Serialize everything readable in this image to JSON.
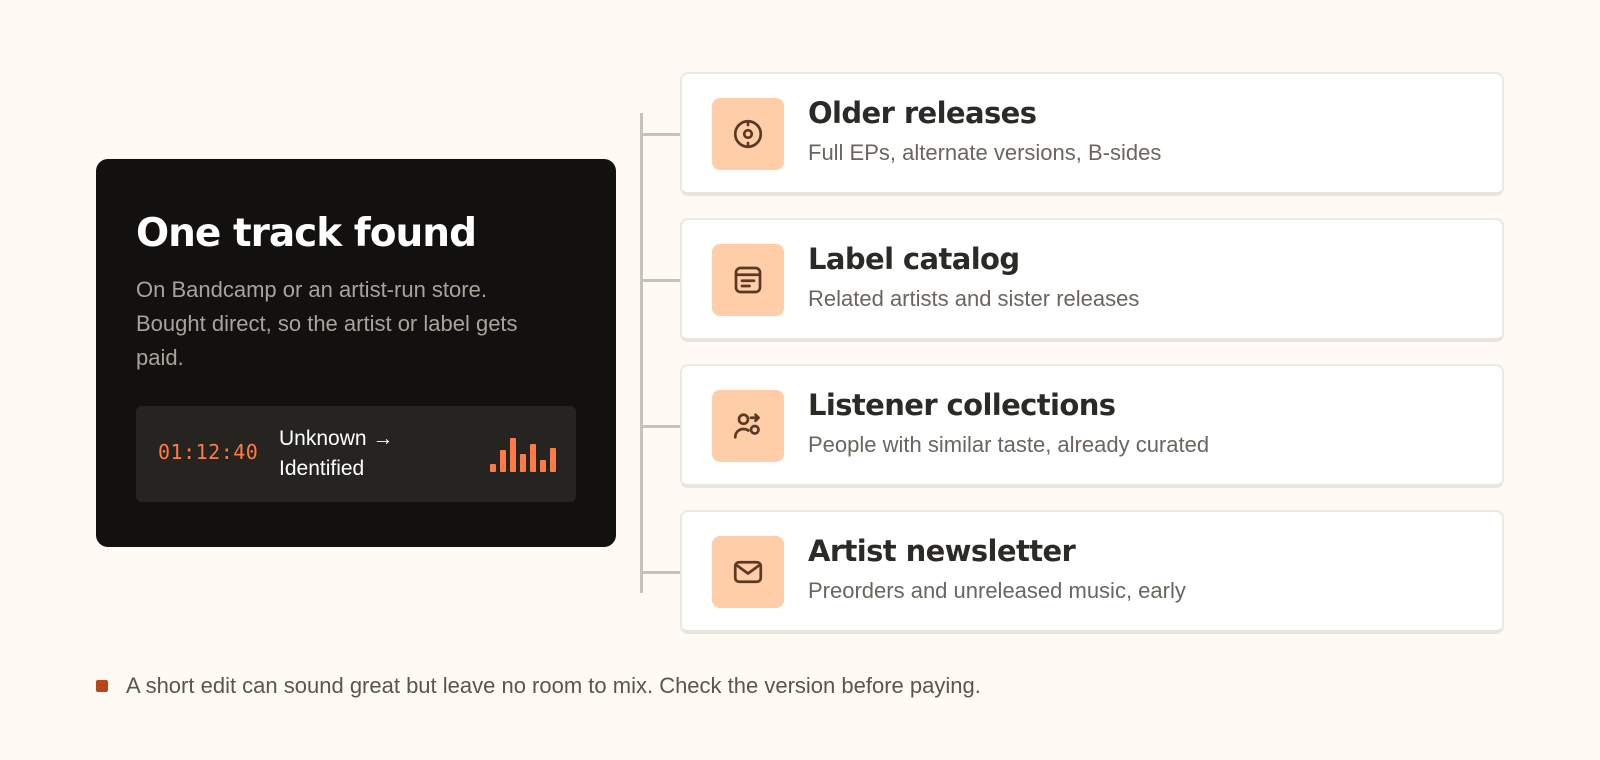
{
  "hero": {
    "title": "One track found",
    "description": "On Bandcamp or an artist-run store. Bought direct, so the artist or label gets paid.",
    "timecode": "01:12:40",
    "status": "Unknown → Identified",
    "equalizer_icon": "equalizer-bars-icon"
  },
  "options": [
    {
      "title": "Older releases",
      "subtitle": "Full EPs, alternate versions, B-sides",
      "icon": "vinyl-disc-icon"
    },
    {
      "title": "Label catalog",
      "subtitle": "Related artists and sister releases",
      "icon": "catalog-box-icon"
    },
    {
      "title": "Listener collections",
      "subtitle": "People with similar taste, already curated",
      "icon": "people-share-icon"
    },
    {
      "title": "Artist newsletter",
      "subtitle": "Preorders and unreleased music, early",
      "icon": "envelope-icon"
    }
  ],
  "note": {
    "text": "A short edit can sound great but leave no room to mix. Check the version before paying."
  },
  "colors": {
    "accent": "#ff7a45",
    "icon_bg": "#ffcda8",
    "dark_card": "#12110f",
    "bullet": "#b8461b",
    "background": "#fffaf4"
  }
}
